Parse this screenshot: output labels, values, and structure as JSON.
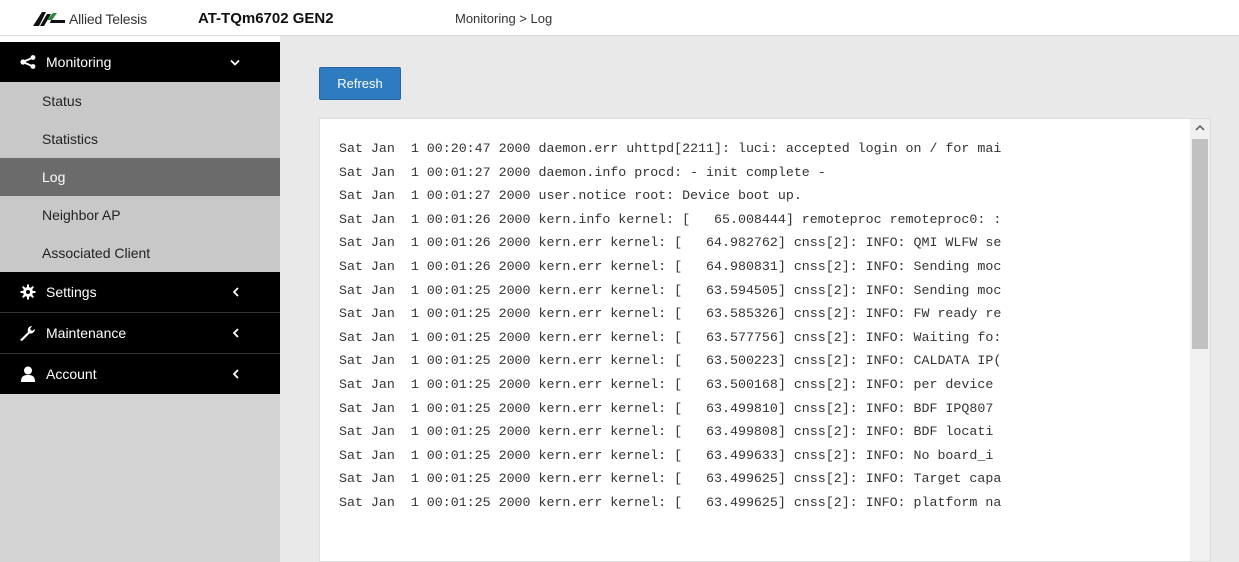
{
  "header": {
    "brand": "Allied Telesis",
    "model": "AT-TQm6702 GEN2",
    "breadcrumb": "Monitoring > Log"
  },
  "sidebar": {
    "monitoring": {
      "label": "Monitoring",
      "items": [
        {
          "label": "Status"
        },
        {
          "label": "Statistics"
        },
        {
          "label": "Log"
        },
        {
          "label": "Neighbor AP"
        },
        {
          "label": "Associated Client"
        }
      ]
    },
    "settings": {
      "label": "Settings"
    },
    "maintenance": {
      "label": "Maintenance"
    },
    "account": {
      "label": "Account"
    }
  },
  "main": {
    "refresh_label": "Refresh",
    "log_lines": [
      "Sat Jan  1 00:20:47 2000 daemon.err uhttpd[2211]: luci: accepted login on / for mai",
      "Sat Jan  1 00:01:27 2000 daemon.info procd: - init complete -",
      "Sat Jan  1 00:01:27 2000 user.notice root: Device boot up.",
      "Sat Jan  1 00:01:26 2000 kern.info kernel: [   65.008444] remoteproc remoteproc0: :",
      "Sat Jan  1 00:01:26 2000 kern.err kernel: [   64.982762] cnss[2]: INFO: QMI WLFW se",
      "Sat Jan  1 00:01:26 2000 kern.err kernel: [   64.980831] cnss[2]: INFO: Sending moc",
      "Sat Jan  1 00:01:25 2000 kern.err kernel: [   63.594505] cnss[2]: INFO: Sending moc",
      "Sat Jan  1 00:01:25 2000 kern.err kernel: [   63.585326] cnss[2]: INFO: FW ready re",
      "Sat Jan  1 00:01:25 2000 kern.err kernel: [   63.577756] cnss[2]: INFO: Waiting fo:",
      "Sat Jan  1 00:01:25 2000 kern.err kernel: [   63.500223] cnss[2]: INFO: CALDATA IP(",
      "Sat Jan  1 00:01:25 2000 kern.err kernel: [   63.500168] cnss[2]: INFO: per device",
      "Sat Jan  1 00:01:25 2000 kern.err kernel: [   63.499810] cnss[2]: INFO: BDF IPQ807",
      "Sat Jan  1 00:01:25 2000 kern.err kernel: [   63.499808] cnss[2]: INFO: BDF locati",
      "Sat Jan  1 00:01:25 2000 kern.err kernel: [   63.499633] cnss[2]: INFO: No board_i",
      "Sat Jan  1 00:01:25 2000 kern.err kernel: [   63.499625] cnss[2]: INFO: Target capa",
      "Sat Jan  1 00:01:25 2000 kern.err kernel: [   63.499625] cnss[2]: INFO: platform na"
    ]
  },
  "colors": {
    "accent": "#2f7bbf",
    "sidebar_bg": "#d4d4d4",
    "active_item": "#6b6b6b",
    "group_header": "#000000"
  }
}
